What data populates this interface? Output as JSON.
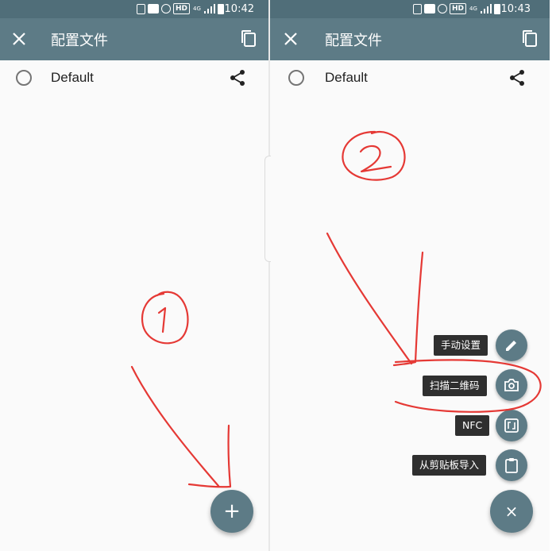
{
  "left": {
    "status_time": "10:42",
    "hd_badge": "HD",
    "network_badge": "4G",
    "title": "配置文件",
    "profile_name": "Default",
    "fab_label": "+"
  },
  "right": {
    "status_time": "10:43",
    "hd_badge": "HD",
    "network_badge": "4G",
    "title": "配置文件",
    "profile_name": "Default",
    "fab_label": "×",
    "menu": [
      {
        "label": "手动设置",
        "icon": "pencil-icon"
      },
      {
        "label": "扫描二维码",
        "icon": "camera-icon"
      },
      {
        "label": "NFC",
        "icon": "nfc-icon"
      },
      {
        "label": "从剪贴板导入",
        "icon": "clipboard-icon"
      }
    ]
  },
  "colors": {
    "statusbar": "#506e79",
    "appbar": "#5d7b86",
    "fab": "#5d7b86",
    "annotation": "#e53935"
  }
}
